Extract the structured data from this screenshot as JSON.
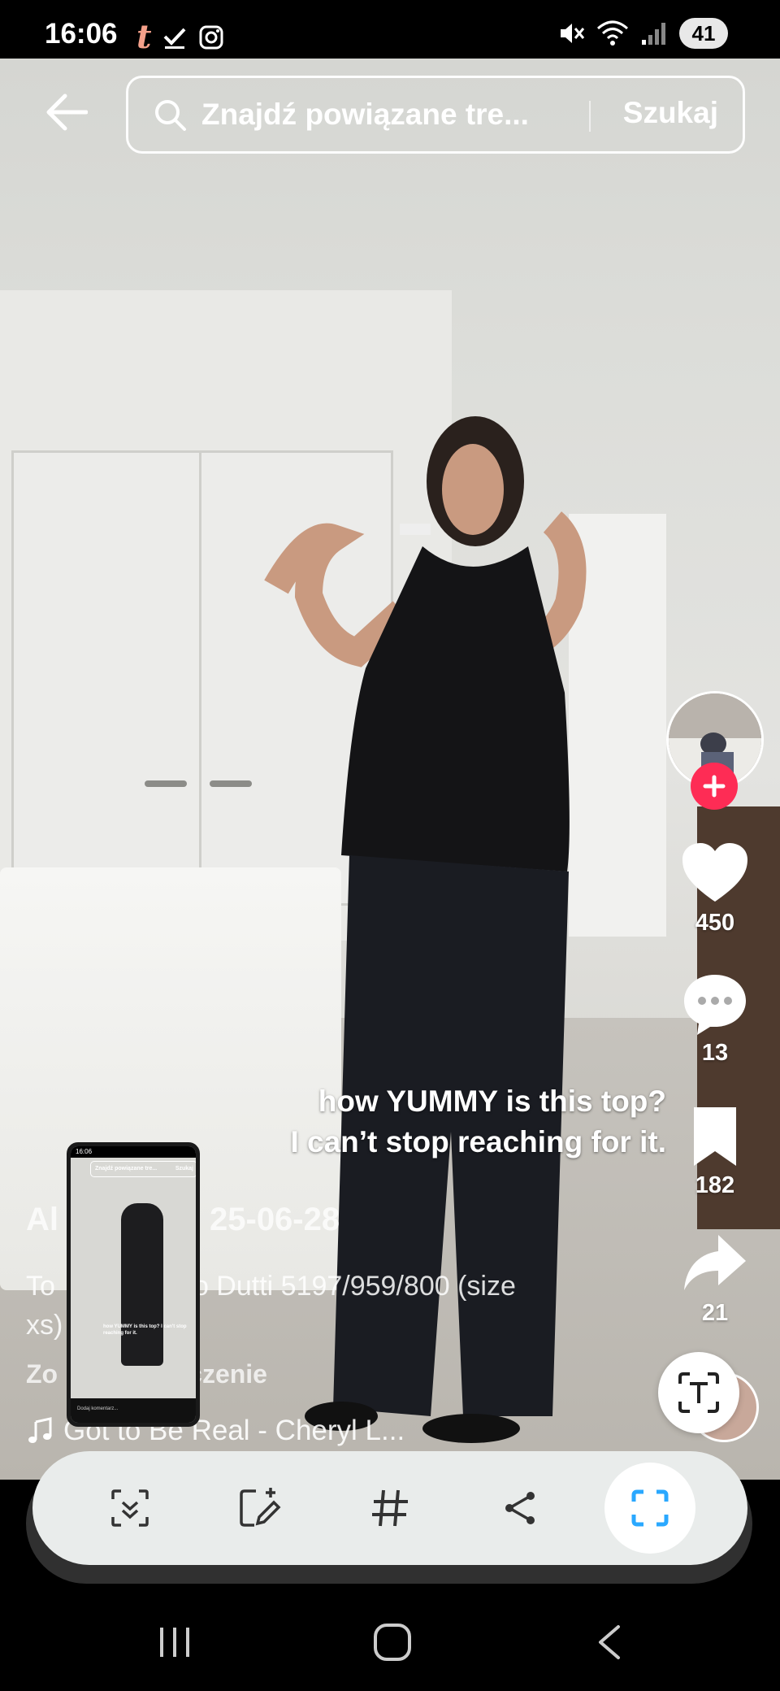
{
  "status_bar": {
    "time": "16:06",
    "battery": "41",
    "left_icons": [
      "tiktok-t-icon",
      "check-icon",
      "instagram-icon"
    ],
    "right_icons": [
      "mute-icon",
      "wifi-icon",
      "signal-icon"
    ]
  },
  "search": {
    "placeholder": "Znajdź powiązane tre...",
    "submit_label": "Szukaj"
  },
  "rail": {
    "likes": "450",
    "comments": "13",
    "saves": "182",
    "shares": "21"
  },
  "caption_overlay": {
    "line1": "how YUMMY is this top?",
    "line2": "I can’t stop reaching for it."
  },
  "post": {
    "author": "Al",
    "date": "25-06-28",
    "description_line1": "To                  o Dutti 5197/959/800 (size",
    "description_line2": "xs)",
    "translation": "Zo                aczenie",
    "music": "Got to Be Real - Cheryl L..."
  },
  "thumbnail": {
    "time": "16:06",
    "search_text": "Znajdź powiązane tre...",
    "search_submit": "Szukaj",
    "caption": "how YUMMY is this top? I can't stop reaching for it.",
    "comment_placeholder": "Dodaj komentarz..."
  },
  "toolbar": {
    "tools": [
      "smart-select-icon",
      "draw-edit-icon",
      "hashtag-icon",
      "share-icon",
      "capture-more-icon"
    ]
  },
  "nav": {
    "buttons": [
      "recents-icon",
      "home-icon",
      "back-icon"
    ]
  },
  "colors": {
    "accent_red": "#fe2c55",
    "capture_active": "#2aa8ff"
  }
}
